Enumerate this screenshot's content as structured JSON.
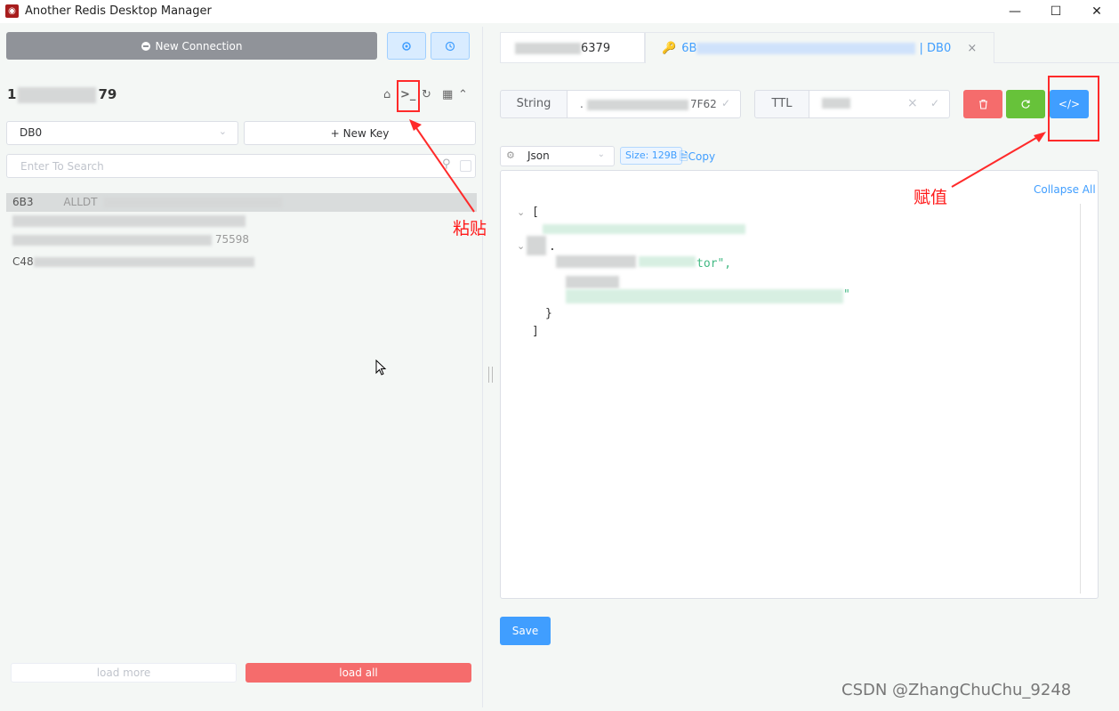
{
  "window": {
    "title": "Another Redis Desktop Manager",
    "icon": "redis-app-icon",
    "controls": {
      "minimize": "—",
      "maximize": "☐",
      "close": "✕"
    }
  },
  "sidebar": {
    "new_connection_label": "New Connection",
    "status_button_icon": "status-icon",
    "history_button_icon": "clock-icon",
    "connection": {
      "name_prefix": "1",
      "name_suffix": "79",
      "icons": [
        "home-icon",
        "terminal-icon",
        "refresh-icon",
        "grid-icon",
        "collapse-icon"
      ]
    },
    "db_select": {
      "value": "DB0"
    },
    "new_key_label": "New Key",
    "search": {
      "placeholder": "Enter To Search"
    },
    "keys": [
      {
        "prefix": "6B3",
        "middle": "ALLDT"
      },
      {
        "prefix": ""
      },
      {
        "prefix": "",
        "suffix": "75598"
      },
      {
        "prefix": "C48"
      }
    ],
    "load_more_label": "load more",
    "load_all_label": "load all"
  },
  "tabs": [
    {
      "label": "6379",
      "active": false
    },
    {
      "prefix": "6B",
      "suffix": "| DB0",
      "close": "×",
      "active": true
    }
  ],
  "key_detail": {
    "type_label": "String",
    "name_suffix": "7F62",
    "name_prefix": ".",
    "ttl_label": "TTL",
    "clear_glyph": "×",
    "confirm_glyph": "✓",
    "actions": {
      "delete_icon": "trash-icon",
      "refresh_icon": "refresh-icon",
      "code_label": "</>"
    },
    "format": {
      "value": "Json"
    },
    "size_badge": "Size: 129B",
    "copy_label": "Copy",
    "collapse_all_label": "Collapse All",
    "json_lines": {
      "open_bracket": "[",
      "line_2": ".",
      "line_3_suffix": "tor\",",
      "line_4_suffix": "\"",
      "close_brace": "}",
      "close_bracket": "]"
    },
    "save_label": "Save"
  },
  "annotations": {
    "paste_label": "粘贴",
    "assign_label": "赋值"
  },
  "watermark": "CSDN @ZhangChuChu_9248",
  "colors": {
    "primary": "#409eff",
    "danger": "#f56c6c",
    "success": "#67c23a",
    "annotation_red": "#ff2a2a"
  }
}
